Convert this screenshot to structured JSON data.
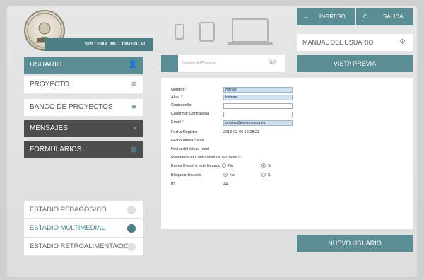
{
  "logo": {
    "banner_text": "SISTEMA MULTIMEDIAL"
  },
  "sidebar": {
    "items": [
      {
        "label": "USUARIO",
        "icon": "user-icon",
        "glyph": "👤"
      },
      {
        "label": "PROYECTO",
        "icon": "close-circle-icon",
        "glyph": "⊗"
      },
      {
        "label": "BANCO DE PROYECTOS",
        "icon": "star-icon",
        "glyph": "★"
      },
      {
        "label": "MENSAJES",
        "icon": "message-icon",
        "glyph": "●"
      },
      {
        "label": "FORMULARIOS",
        "icon": "grid-icon",
        "glyph": "▦"
      }
    ]
  },
  "stages": [
    {
      "label": "ESTADIO PEDAGÓGICO"
    },
    {
      "label": "ESTADIO MULTIMEDIAL"
    },
    {
      "label": "ESTADIO RETROALIMENTACIÓN"
    }
  ],
  "search": {
    "placeholder": "Nombre del Proyecto",
    "phone_glyph": "☏"
  },
  "form": {
    "labels": {
      "nombre": "Nombre",
      "alias": "Alias",
      "contrasena": "Contraseña",
      "confirmar": "Confirmar Contraseña",
      "email": "Email",
      "fecha_registro": "Fecha Registro",
      "fecha_visita": "Fecha última Visita",
      "fecha_reset": "Fecha del último reset",
      "reestablecer": "Reestablecer Contraseña de la cuenta",
      "reestablecer_val": "0",
      "enviar": "Enviar E-mail a este Usuario",
      "bloquear": "Bloquear Usuario",
      "id": "ID"
    },
    "required_mark": "*",
    "values": {
      "nombre": "Hicham",
      "alias": "hicham",
      "email": "prueba@webempresa.eu",
      "fecha_registro": "2013-02-06 12:28:23",
      "id": "44"
    },
    "radios": {
      "no": "No",
      "si": "Si"
    }
  },
  "header": {
    "ingreso": {
      "label": "INGRESO",
      "glyph": "←"
    },
    "salida": {
      "label": "SALIDA",
      "glyph": "⏻"
    }
  },
  "manual": {
    "label": "MANUAL DEL USUARIO",
    "glyph": "⚙"
  },
  "buttons": {
    "vista_previa": "VISTA PREVIA",
    "nuevo_usuario": "NUEVO USUARIO"
  }
}
